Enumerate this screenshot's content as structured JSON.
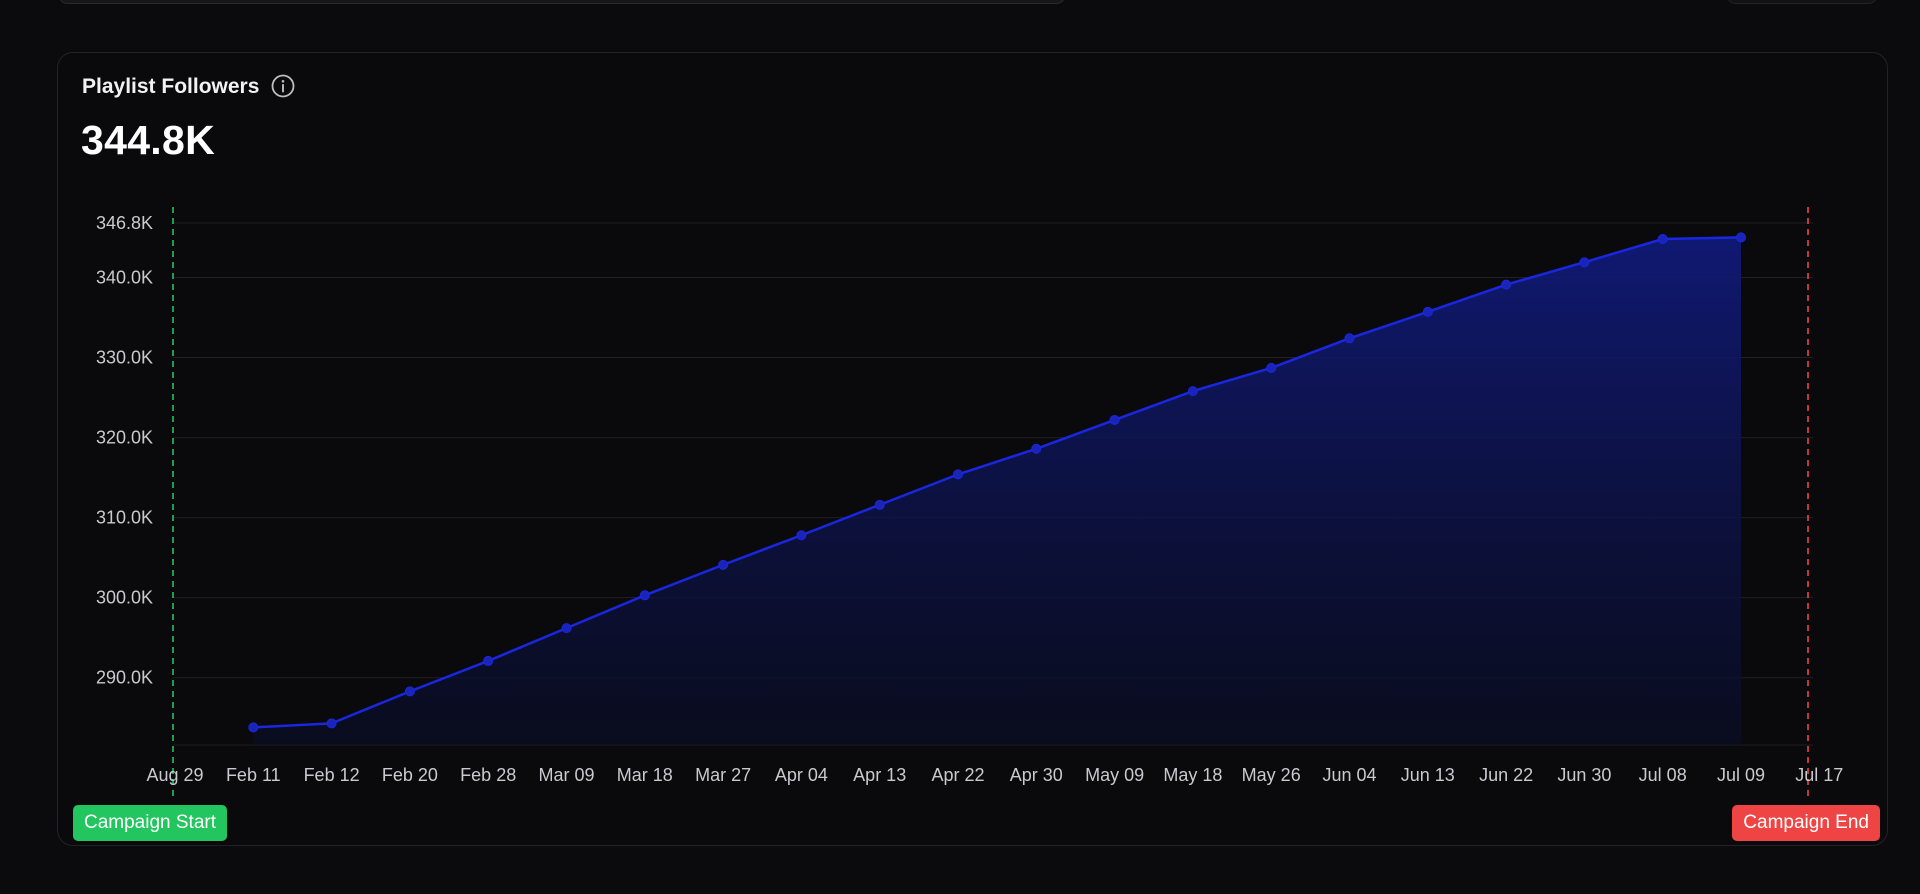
{
  "card": {
    "title": "Playlist Followers",
    "value": "344.8K",
    "info_icon": "info-circle-icon"
  },
  "markers": {
    "start_label": "Campaign Start",
    "end_label": "Campaign End",
    "start_color": "#22c55e",
    "end_color": "#ef4444"
  },
  "colors": {
    "line": "#1a27e0",
    "area_top": "#101a78",
    "background": "#0a0a0c",
    "grid": "#1f1f24"
  },
  "chart_data": {
    "type": "area",
    "y_ticks": [
      "346.8K",
      "340.0K",
      "330.0K",
      "320.0K",
      "310.0K",
      "300.0K",
      "290.0K"
    ],
    "y_tick_values": [
      346800,
      340000,
      330000,
      320000,
      310000,
      300000,
      290000
    ],
    "ylim": [
      281600,
      346800
    ],
    "x_ticks": [
      "Aug 29",
      "Feb 11",
      "Feb 12",
      "Feb 20",
      "Feb 28",
      "Mar 09",
      "Mar 18",
      "Mar 27",
      "Apr 04",
      "Apr 13",
      "Apr 22",
      "Apr 30",
      "May 09",
      "May 18",
      "May 26",
      "Jun 04",
      "Jun 13",
      "Jun 22",
      "Jun 30",
      "Jul 08",
      "Jul 09",
      "Jul 17"
    ],
    "categories": [
      "Feb 11",
      "Feb 12",
      "Feb 20",
      "Feb 28",
      "Mar 09",
      "Mar 18",
      "Mar 27",
      "Apr 04",
      "Apr 13",
      "Apr 22",
      "Apr 30",
      "May 09",
      "May 18",
      "May 26",
      "Jun 04",
      "Jun 13",
      "Jun 22",
      "Jun 30",
      "Jul 08",
      "Jul 09"
    ],
    "series": [
      {
        "values": [
          283800,
          284300,
          288300,
          292100,
          296200,
          300300,
          304100,
          307800,
          311600,
          315400,
          318600,
          322200,
          325800,
          328700,
          332400,
          335700,
          339100,
          341900,
          344800,
          345000
        ]
      }
    ],
    "markers": [
      {
        "label": "Campaign Start",
        "at": "Aug 29"
      },
      {
        "label": "Campaign End",
        "at": "Jul 17"
      }
    ],
    "grid": true
  }
}
